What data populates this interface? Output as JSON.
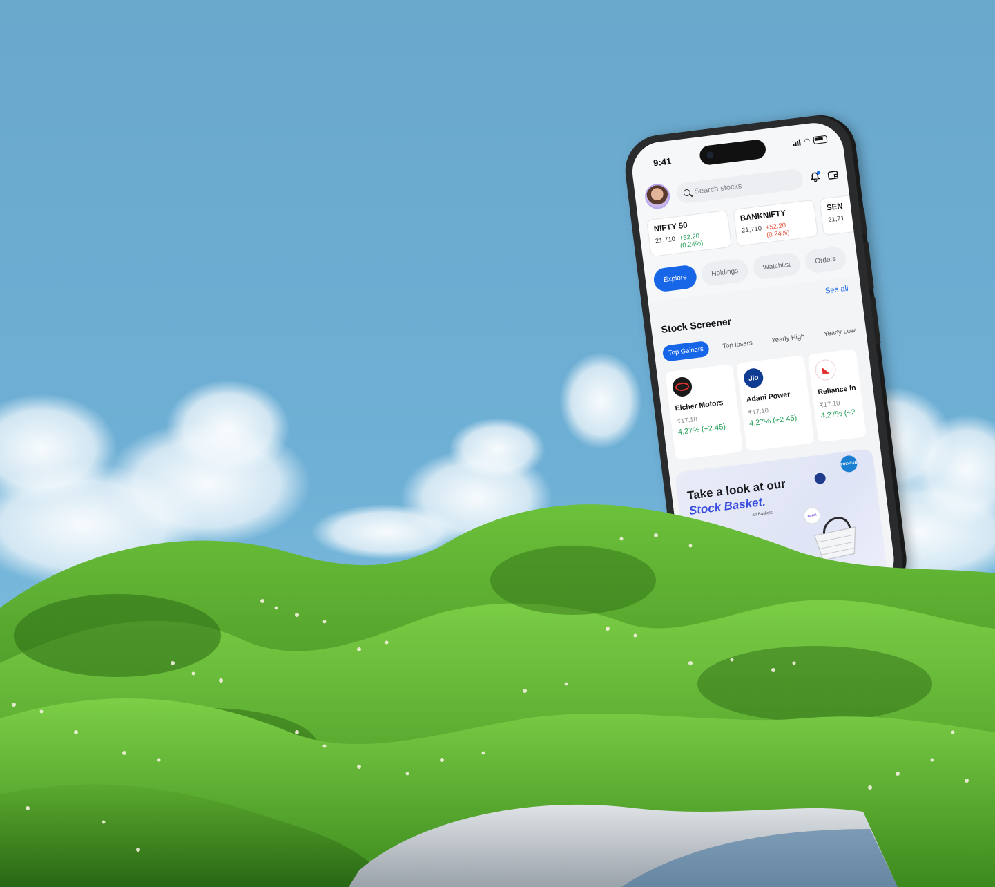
{
  "status": {
    "time": "9:41"
  },
  "header": {
    "search_placeholder": "Search stocks"
  },
  "indices": [
    {
      "name": "NIFTY 50",
      "value": "21,710",
      "change": "+52.20 (0.24%)",
      "direction": "up"
    },
    {
      "name": "BANKNIFTY",
      "value": "21,710",
      "change": "+52.20 (0.24%)",
      "direction": "down"
    },
    {
      "name": "SEN",
      "value": "21,71",
      "change": "",
      "direction": "up"
    }
  ],
  "tabs": [
    {
      "label": "Explore",
      "active": true
    },
    {
      "label": "Holdings",
      "active": false
    },
    {
      "label": "Watchlist",
      "active": false
    },
    {
      "label": "Orders",
      "active": false
    }
  ],
  "screener": {
    "title": "Stock Screener",
    "see_all": "See all",
    "chips": [
      {
        "label": "Top Gainers",
        "active": true
      },
      {
        "label": "Top losers",
        "active": false
      },
      {
        "label": "Yearly High",
        "active": false
      },
      {
        "label": "Yearly Low",
        "active": false
      }
    ],
    "stocks": [
      {
        "name": "Eicher Motors",
        "price": "₹17.10",
        "change": "4.27% (+2.45)",
        "logo_color": "#1a1a1a",
        "logo_text": ""
      },
      {
        "name": "Adani Power",
        "price": "₹17.10",
        "change": "4.27% (+2.45)",
        "logo_color": "#0f3c91",
        "logo_text": "Jio"
      },
      {
        "name": "Reliance In",
        "price": "₹17.10",
        "change": "4.27% (+2",
        "logo_color": "#ffffff",
        "logo_text": ""
      }
    ]
  },
  "banner": {
    "line1": "Take a look at our",
    "line2": "Stock Basket.",
    "small_text": "ad Baskets",
    "logo_text": "POLYCAB",
    "adani_text": "adani"
  },
  "colors": {
    "sky_top": "#6aa8cc",
    "sky_bottom": "#7cc0e0",
    "grass": "#4f9e24",
    "accent": "#1766e8",
    "positive": "#1f9d55",
    "negative": "#e0533b"
  }
}
